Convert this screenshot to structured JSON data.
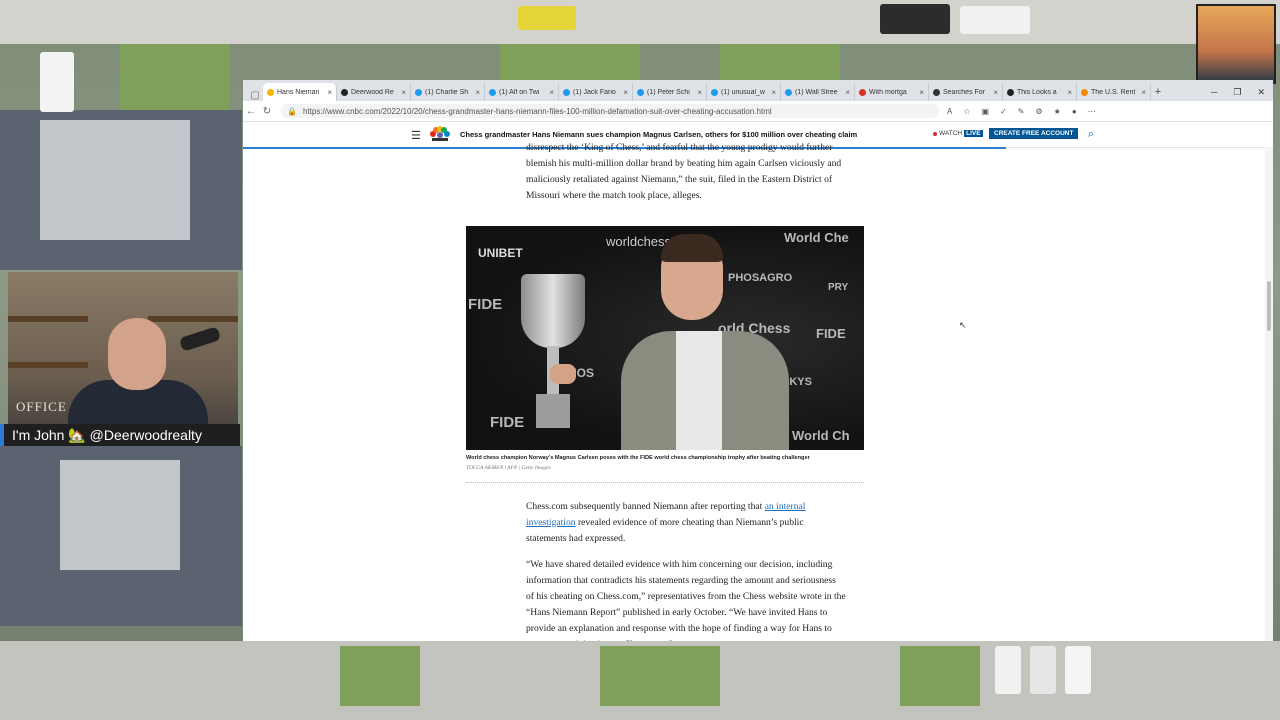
{
  "webcam": {
    "name_tag": "I'm John 🏡 @Deerwoodrealty",
    "wall_sign": "OFFICE"
  },
  "browser": {
    "tabs": [
      {
        "label": "Hans Nieman",
        "active": true,
        "icon_color": "#f7b500"
      },
      {
        "label": "Deerwood Re",
        "active": false,
        "icon_color": "#222222"
      },
      {
        "label": "(1) Charlie Sh",
        "active": false,
        "icon_color": "#1d9bf0"
      },
      {
        "label": "(1) Alf on Twi",
        "active": false,
        "icon_color": "#1d9bf0"
      },
      {
        "label": "(1) Jack Fario",
        "active": false,
        "icon_color": "#1d9bf0"
      },
      {
        "label": "(1) Peter Schi",
        "active": false,
        "icon_color": "#1d9bf0"
      },
      {
        "label": "(1) unusual_w",
        "active": false,
        "icon_color": "#1d9bf0"
      },
      {
        "label": "(1) Wall Stree",
        "active": false,
        "icon_color": "#1d9bf0"
      },
      {
        "label": "With mortga",
        "active": false,
        "icon_color": "#d93025"
      },
      {
        "label": "Searches For",
        "active": false,
        "icon_color": "#333333"
      },
      {
        "label": "This Looks a",
        "active": false,
        "icon_color": "#222222"
      },
      {
        "label": "The U.S. Rent",
        "active": false,
        "icon_color": "#f28b00"
      }
    ],
    "url": "https://www.cnbc.com/2022/10/20/chess-grandmaster-hans-niemann-files-100-million-defamation-suit-over-cheating-accusation.html"
  },
  "site": {
    "headline": "Chess grandmaster Hans Niemann sues champion Magnus Carlsen, others for $100 million over cheating claim",
    "watch_label": "WATCH",
    "live_label": "LIVE",
    "cta_label": "CREATE FREE ACCOUNT",
    "brand_color": "#005594"
  },
  "article": {
    "para1": "disrespect the ‘King of Chess,’ and fearful that the young prodigy would further blemish his multi-million dollar brand by beating him again Carlsen viciously and maliciously retaliated against Niemann,” the suit, filed in the Eastern District of Missouri where the match took place, alleges.",
    "caption": "World chess champion Norway's Magnus Carlsen poses with the FIDE world chess championship trophy after beating challenger",
    "credit": "TOLGA AKMEN | AFP | Getty Images",
    "para2_before": "Chess.com subsequently banned Niemann after reporting that ",
    "para2_link": "an internal investigation",
    "para2_after": " revealed evidence of more cheating than Niemann’s public statements had expressed.",
    "para3": "“We have shared detailed evidence with him concerning our decision, including information that contradicts his statements regarding the amount and seriousness of his cheating on Chess.com,” representatives from the Chess website wrote in the “Hans Niemann Report” published in early October. “We have invited Hans to provide an explanation and response with the hope of finding a way for Hans to return to participating on Chess.com.”"
  },
  "photo_text": {
    "b1": "UNIBET",
    "b2": "worldchess.com",
    "b3": "World Che",
    "b4": "FIDE",
    "b5": "PHOSAGRO",
    "b6": "PRY",
    "b7": "orld Chess",
    "b8": "FIDE",
    "b9": "PHOS",
    "b10": "FIDE",
    "b11": "World Ch",
    "b12": "SKYS"
  }
}
